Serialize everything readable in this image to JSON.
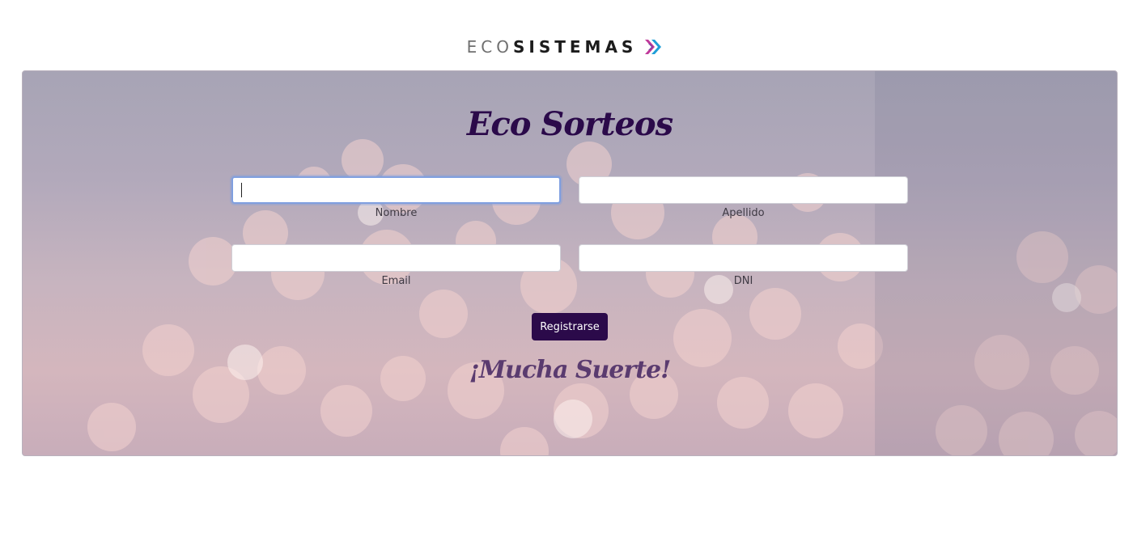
{
  "brand": {
    "logo_prefix": "ECO",
    "logo_suffix": "SISTEMAS",
    "logo_icon": "double-chevron-right-icon"
  },
  "form": {
    "title": "Eco Sorteos",
    "fields": {
      "nombre": {
        "label": "Nombre",
        "value": "",
        "placeholder": ""
      },
      "apellido": {
        "label": "Apellido",
        "value": "",
        "placeholder": ""
      },
      "email": {
        "label": "Email",
        "value": "",
        "placeholder": ""
      },
      "dni": {
        "label": "DNI",
        "value": "",
        "placeholder": ""
      }
    },
    "submit_label": "Registrarse",
    "footer_text": "¡Mucha Suerte!"
  },
  "colors": {
    "accent": "#2b0a4a",
    "footer_text": "#5a3b6f",
    "focus_ring": "#7f9fe0"
  }
}
